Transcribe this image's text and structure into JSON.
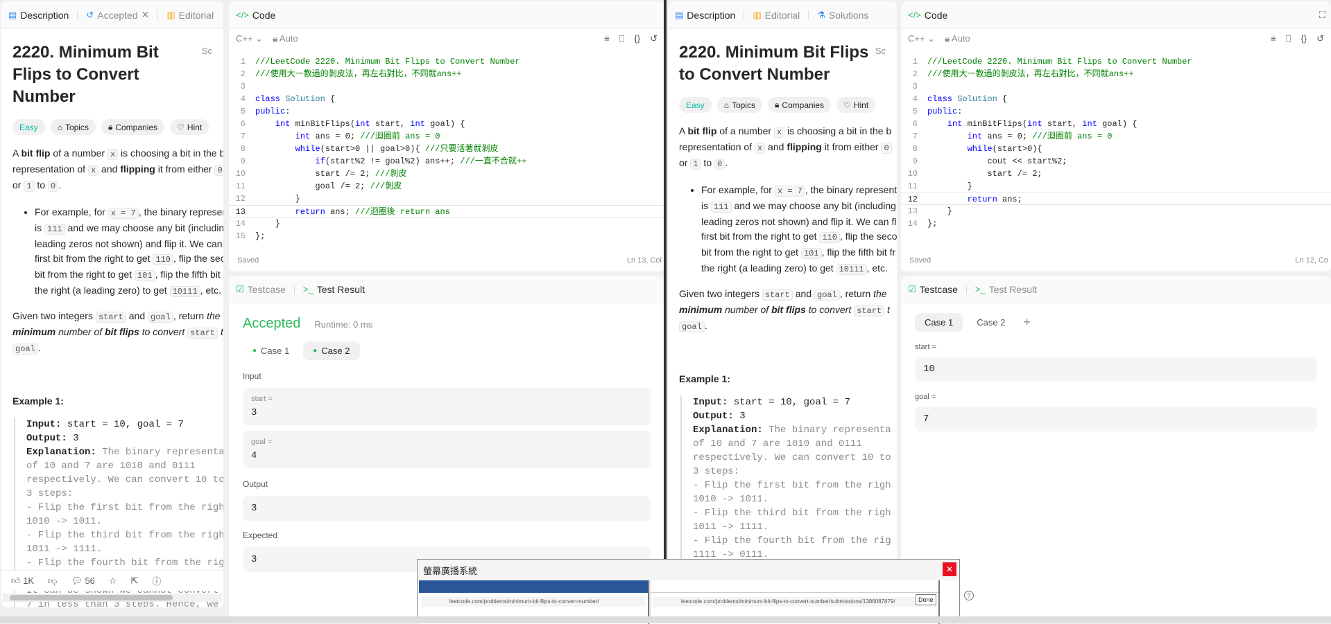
{
  "left": {
    "tabs": [
      {
        "label": "Description",
        "icon": "description-icon",
        "active": true
      },
      {
        "label": "Accepted",
        "icon": "history-icon"
      },
      {
        "label": "Editorial",
        "icon": "book-icon"
      }
    ],
    "problem_title": "2220. Minimum Bit Flips to Convert Number",
    "side_cut": "Sc",
    "badges": [
      "Easy",
      "Topics",
      "Companies",
      "Hint"
    ],
    "p1": {
      "a": "A ",
      "b1": "bit flip",
      "c": " of a number ",
      "x": "x",
      "d": " is choosing a bit in the b",
      "line2a": "representation of ",
      "x2": "x",
      "and": " and ",
      "b2": "flipping",
      "line2b": " it from either ",
      "zero": "0",
      "line3a": "or ",
      "one": "1",
      "to": " to ",
      "zero2": "0",
      "end": "."
    },
    "bullet": {
      "t1": "For example, for ",
      "c1": "x = 7",
      "t2": ", the binary representat",
      "t3": "is ",
      "c2": "111",
      "t4": " and we may choose any bit (including a",
      "t5": "leading zeros not shown) and flip it. We can flip",
      "t6": "first bit from the right to get ",
      "c3": "110",
      "t7": ", flip the seco",
      "t8": "bit from the right to get ",
      "c4": "101",
      "t9": ", flip the fifth bit fr",
      "t10": "the right (a leading zero) to get ",
      "c5": "10111",
      "t11": ", etc."
    },
    "p2": {
      "a": "Given two integers ",
      "s": "start",
      "and": " and ",
      "g": "goal",
      "b": ", return ",
      "the": "the",
      "min": "minimum",
      "c": " number of ",
      "bf": "bit flips",
      "d": " to convert ",
      "s2": "start",
      "t": " t",
      "g2": "goal",
      "end": "."
    },
    "example_title": "Example 1:",
    "example": {
      "input_label": "Input:",
      "input": " start = 10, goal = 7",
      "output_label": "Output:",
      "output": " 3",
      "expl_label": "Explanation:",
      "l1": " The binary representa",
      "l2": "of 10 and 7 are 1010 and 0111",
      "l3": "respectively. We can convert 10 to",
      "l4": "3 steps:",
      "l5": "- Flip the first bit from the righ",
      "l6": "1010 -> 1011.",
      "l7": "- Flip the third bit from the righ",
      "l8": "1011 -> 1111.",
      "l9": "- Flip the fourth bit from the rig",
      "l10": "1111 -> 0111.",
      "l11": "It can be shown we cannot convert",
      "l12": "7 in less than 3 steps. Hence, we"
    },
    "bottom": {
      "likes": "1K",
      "comments": "56"
    },
    "code_panel": {
      "title": "Code",
      "lang": "C++",
      "auto": "Auto",
      "status": "Saved",
      "cursor": "Ln 13, Col",
      "lines": [
        "///LeetCode 2220. Minimum Bit Flips to Convert Number",
        "///使用大一教過的剝皮法，再左右對比，不同就ans++",
        "",
        "class Solution {",
        "public:",
        "    int minBitFlips(int start, int goal) {",
        "        int ans = 0; ///迴圈前 ans = 0",
        "        while(start>0 || goal>0){ ///只要活著就剝皮",
        "            if(start%2 != goal%2) ans++; ///一直不合就++",
        "            start /= 2; ///剝皮",
        "            goal /= 2; ///剝皮",
        "        }",
        "        return ans; ///迴圈後 return ans",
        "    }",
        "};"
      ]
    },
    "result_panel": {
      "tab1": "Testcase",
      "tab2": "Test Result",
      "status": "Accepted",
      "runtime": "Runtime: 0 ms",
      "cases": [
        "Case 1",
        "Case 2"
      ],
      "input_label": "Input",
      "start_label": "start =",
      "start_val": "3",
      "goal_label": "goal =",
      "goal_val": "4",
      "output_label": "Output",
      "output_val": "3",
      "expected_label": "Expected",
      "expected_val": "3"
    }
  },
  "right": {
    "tabs": [
      {
        "label": "Description",
        "icon": "description-icon",
        "active": true
      },
      {
        "label": "Editorial",
        "icon": "book-icon"
      },
      {
        "label": "Solutions",
        "icon": "flask-icon"
      }
    ],
    "code_panel": {
      "title": "Code",
      "lang": "C++",
      "auto": "Auto",
      "status": "Saved",
      "cursor": "Ln 12, Co",
      "lines": [
        "///LeetCode 2220. Minimum Bit Flips to Convert Number",
        "///使用大一教過的剝皮法，再左右對比，不同就ans++",
        "",
        "class Solution {",
        "public:",
        "    int minBitFlips(int start, int goal) {",
        "        int ans = 0; ///迴圈前 ans = 0",
        "        while(start>0){",
        "            cout << start%2;",
        "            start /= 2;",
        "        }",
        "        return ans;",
        "    }",
        "};"
      ]
    },
    "testcase_panel": {
      "tab1": "Testcase",
      "tab2": "Test Result",
      "cases": [
        "Case 1",
        "Case 2"
      ],
      "add": "+",
      "start_label": "start =",
      "start_val": "10",
      "goal_label": "goal =",
      "goal_val": "7"
    }
  },
  "popup": {
    "title": "螢幕廣播系統",
    "close": "✕",
    "url1": "leetcode.com/problems/minimum-bit-flips-to-convert-number/",
    "url2": "leetcode.com/problems/minimum-bit-flips-to-convert-number/submissions/1386087879/",
    "done": "Done"
  }
}
